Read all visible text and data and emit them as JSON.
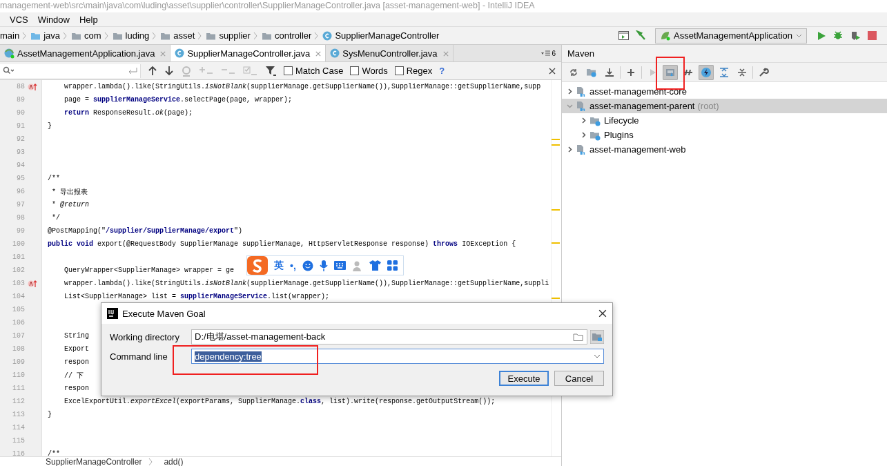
{
  "window": {
    "title": "management-web\\src\\main\\java\\com\\luding\\asset\\supplier\\controller\\SupplierManageController.java [asset-management-web] - IntelliJ IDEA"
  },
  "menu": [
    "VCS",
    "Window",
    "Help"
  ],
  "breadcrumb": [
    {
      "label": "main",
      "kind": "plain"
    },
    {
      "label": "java",
      "kind": "source-folder"
    },
    {
      "label": "com",
      "kind": "folder"
    },
    {
      "label": "luding",
      "kind": "folder"
    },
    {
      "label": "asset",
      "kind": "folder"
    },
    {
      "label": "supplier",
      "kind": "folder"
    },
    {
      "label": "controller",
      "kind": "folder"
    },
    {
      "label": "SupplierManageController",
      "kind": "class"
    }
  ],
  "run_config": {
    "label": "AssetManagementApplication"
  },
  "tabs": [
    {
      "label": "AssetManagementApplication.java",
      "selected": false,
      "kind": "app"
    },
    {
      "label": "SupplierManageController.java",
      "selected": true,
      "kind": "class"
    },
    {
      "label": "SysMenuController.java",
      "selected": false,
      "kind": "class"
    }
  ],
  "tab_overflow": "6",
  "find_bar": {
    "options": [
      {
        "label": "Match Case",
        "checked": false
      },
      {
        "label": "Words",
        "checked": false
      },
      {
        "label": "Regex",
        "checked": false
      }
    ],
    "help": "?"
  },
  "code": [
    {
      "number": "88",
      "text": "    wrapper.lambda().like(StringUtils.*isNotBlank*(supplierManage.getSupplierName()),SupplierManage::getSupplierName,supp",
      "gutter_icon": true
    },
    {
      "number": "89",
      "text": "    page = **supplierManageService**.selectPage(page, wrapper);",
      "gutter_icon": false
    },
    {
      "number": "90",
      "text": "    **return** ResponseResult.*ok*(page);",
      "gutter_icon": false
    },
    {
      "number": "91",
      "text": "}",
      "gutter_icon": false
    },
    {
      "number": "92",
      "gutter_icon": false
    },
    {
      "number": "93",
      "gutter_icon": false
    },
    {
      "number": "94",
      "gutter_icon": false
    },
    {
      "number": "95",
      "text": "/**",
      "gutter_icon": false
    },
    {
      "number": "96",
      "text": " * 导出报表",
      "gutter_icon": false
    },
    {
      "number": "97",
      "text": " * *@return*",
      "gutter_icon": false
    },
    {
      "number": "98",
      "text": " */",
      "gutter_icon": false
    },
    {
      "number": "99",
      "text": "@PostMapping(\"**/supplier/SupplierManage/export**\")",
      "gutter_icon": false
    },
    {
      "number": "100",
      "text": "**public void** export(@RequestBody SupplierManage supplierManage, HttpServletResponse response) **throws** IOException {",
      "gutter_icon": false
    },
    {
      "number": "101",
      "gutter_icon": false
    },
    {
      "number": "102",
      "text": "    QueryWrapper<SupplierManage> wrapper = ge",
      "gutter_icon": false
    },
    {
      "number": "103",
      "text": "    wrapper.lambda().like(StringUtils.*isNotBlank*(supplierManage.getSupplierName()),SupplierManage::getSupplierName,suppli",
      "gutter_icon": true
    },
    {
      "number": "104",
      "text": "    List<SupplierManage> list = **supplierManageService**.list(wrapper);",
      "gutter_icon": false
    },
    {
      "number": "105",
      "gutter_icon": false
    },
    {
      "number": "106",
      "gutter_icon": false
    },
    {
      "number": "107",
      "text": "    String",
      "gutter_icon": false
    },
    {
      "number": "108",
      "text": "    Export",
      "gutter_icon": false
    },
    {
      "number": "109",
      "text": "    respon",
      "gutter_icon": false
    },
    {
      "number": "110",
      "text": "    // 下",
      "gutter_icon": false
    },
    {
      "number": "111",
      "text": "    respon",
      "gutter_icon": false
    },
    {
      "number": "112",
      "text": "    ExcelExportUtil.*exportExcel*(exportParams, SupplierManage.**class**, list).write(response.getOutputStream());",
      "gutter_icon": false
    },
    {
      "number": "113",
      "text": "}",
      "gutter_icon": false
    },
    {
      "number": "114",
      "gutter_icon": false
    },
    {
      "number": "115",
      "gutter_icon": false
    },
    {
      "number": "116",
      "text": "/**",
      "gutter_icon": false
    }
  ],
  "editor_breadcrumb": [
    "SupplierManageController",
    "add()"
  ],
  "maven": {
    "title": "Maven",
    "toolbar": [
      {
        "kind": "reload",
        "on": false
      },
      {
        "kind": "import",
        "on": false
      },
      {
        "kind": "download",
        "on": false
      },
      {
        "kind": "separator"
      },
      {
        "kind": "add",
        "on": false
      },
      {
        "kind": "separator"
      },
      {
        "kind": "run",
        "on": false
      },
      {
        "kind": "goal",
        "on": true
      },
      {
        "kind": "offline",
        "on": false
      },
      {
        "kind": "skip-tests",
        "on": true
      },
      {
        "kind": "expand",
        "on": false
      },
      {
        "kind": "collapse",
        "on": false
      },
      {
        "kind": "separator"
      },
      {
        "kind": "settings",
        "on": false
      }
    ],
    "tree": [
      {
        "label": "asset-management-core",
        "kind": "module",
        "expanded": false,
        "selected": false
      },
      {
        "label": "asset-management-parent",
        "note": "(root)",
        "kind": "module",
        "expanded": true,
        "selected": true,
        "children": [
          {
            "label": "Lifecycle",
            "kind": "group",
            "expanded": false,
            "selected": false
          },
          {
            "label": "Plugins",
            "kind": "group",
            "expanded": false,
            "selected": false
          }
        ]
      },
      {
        "label": "asset-management-web",
        "kind": "module",
        "expanded": false,
        "selected": false
      }
    ]
  },
  "ime_bar": {
    "mode": "英",
    "punct": "•,"
  },
  "dialog": {
    "title": "Execute Maven Goal",
    "working_directory": {
      "label": "Working directory",
      "value": "D:/电堪/asset-management-back"
    },
    "command_line": {
      "label": "Command line",
      "value": "dependency:tree"
    },
    "buttons": [
      {
        "label": "Execute",
        "kind": "primary"
      },
      {
        "label": "Cancel",
        "kind": "normal"
      }
    ]
  }
}
